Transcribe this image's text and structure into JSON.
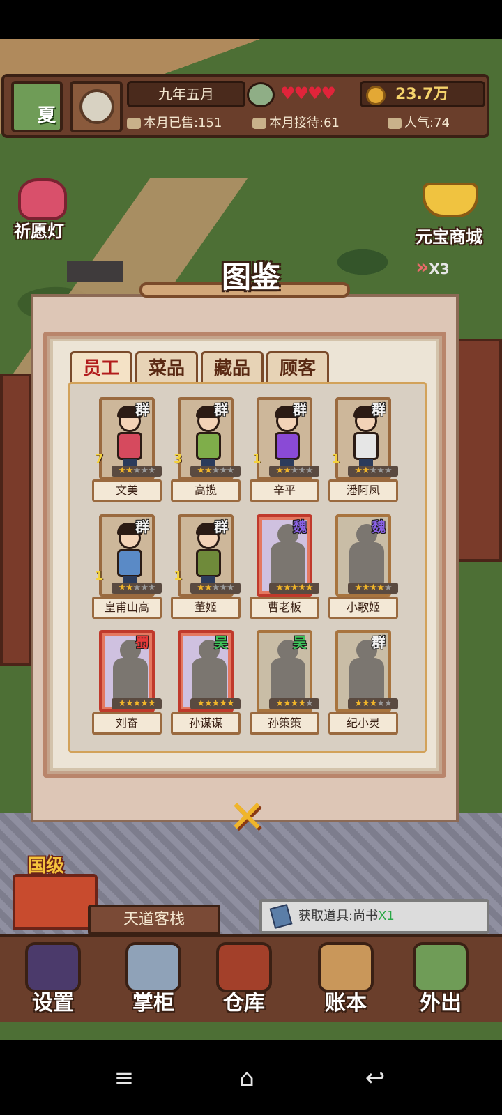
{
  "hud": {
    "season": "夏",
    "date": "九年五月",
    "hearts": "♥♥♥♥",
    "coins": "23.7万",
    "sold_label": "本月已售:",
    "sold_value": "151",
    "served_label": "本月接待:",
    "served_value": "61",
    "popularity_label": "人气:",
    "popularity_value": "74"
  },
  "scene": {
    "left_button": "祈愿灯",
    "right_button": "元宝商城",
    "speed": "X3"
  },
  "modal": {
    "title": "图鉴",
    "tabs": [
      {
        "label": "员工",
        "active": true
      },
      {
        "label": "菜品",
        "active": false
      },
      {
        "label": "藏品",
        "active": false
      },
      {
        "label": "顾客",
        "active": false
      }
    ],
    "cards": [
      {
        "name": "文美",
        "faction": "群",
        "faction_class": "qun",
        "level": "7",
        "stars": 2,
        "unlocked": true,
        "outfit": "#d64a5e"
      },
      {
        "name": "高揽",
        "faction": "群",
        "faction_class": "qun",
        "level": "3",
        "stars": 2,
        "unlocked": true,
        "outfit": "#7fae4a"
      },
      {
        "name": "辛平",
        "faction": "群",
        "faction_class": "qun",
        "level": "1",
        "stars": 2,
        "unlocked": true,
        "outfit": "#8a4ad6"
      },
      {
        "name": "潘阿凤",
        "faction": "群",
        "faction_class": "qun",
        "level": "1",
        "stars": 2,
        "unlocked": true,
        "outfit": "#e6e6e6"
      },
      {
        "name": "皇甫山高",
        "faction": "群",
        "faction_class": "qun",
        "level": "1",
        "stars": 2,
        "unlocked": true,
        "outfit": "#5a8ac6"
      },
      {
        "name": "董姬",
        "faction": "群",
        "faction_class": "qun",
        "level": "1",
        "stars": 2,
        "unlocked": true,
        "outfit": "#6f8a3a"
      },
      {
        "name": "曹老板",
        "faction": "魏",
        "faction_class": "wei",
        "level": "",
        "stars": 5,
        "unlocked": false,
        "frame": "red"
      },
      {
        "name": "小歌姬",
        "faction": "魏",
        "faction_class": "wei",
        "level": "",
        "stars": 4,
        "unlocked": false,
        "frame": "gold"
      },
      {
        "name": "刘奋",
        "faction": "蜀",
        "faction_class": "shu",
        "level": "",
        "stars": 5,
        "unlocked": false,
        "frame": "red"
      },
      {
        "name": "孙谋谋",
        "faction": "吴",
        "faction_class": "wu",
        "level": "",
        "stars": 5,
        "unlocked": false,
        "frame": "red"
      },
      {
        "name": "孙策策",
        "faction": "吴",
        "faction_class": "wu",
        "level": "",
        "stars": 4,
        "unlocked": false,
        "frame": "gold"
      },
      {
        "name": "纪小灵",
        "faction": "群",
        "faction_class": "qun",
        "level": "",
        "stars": 3,
        "unlocked": false,
        "frame": "gold"
      }
    ],
    "close_symbol": "✕"
  },
  "inn": {
    "rank": "国级",
    "name": "天道客栈"
  },
  "notice": {
    "text": "获取道具:尚书",
    "quantity": "X1"
  },
  "bottom_nav": [
    {
      "label": "设置",
      "color": "#4b3a6b"
    },
    {
      "label": "掌柜",
      "color": "#8fa2b8"
    },
    {
      "label": "仓库",
      "color": "#a3402a"
    },
    {
      "label": "账本",
      "color": "#c9975a"
    },
    {
      "label": "外出",
      "color": "#6f9c57"
    }
  ],
  "system_nav": {
    "menu": "≡",
    "home": "⌂",
    "back": "↩"
  }
}
